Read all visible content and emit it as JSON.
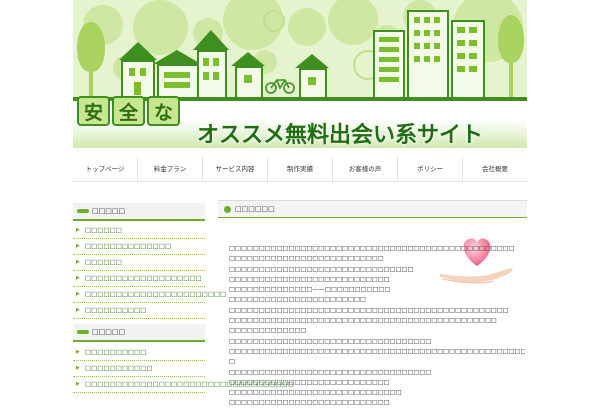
{
  "tagline": "□□□□□□□□□□□□□□□",
  "banner": {
    "badge_chars": [
      "安",
      "全",
      "な"
    ],
    "title": "オススメ無料出会い系サイト"
  },
  "nav": {
    "items": [
      "トップページ",
      "料金プラン",
      "サービス内容",
      "制作実績",
      "お客様の声",
      "ポリシー",
      "会社概要"
    ]
  },
  "sidebar": {
    "section1": {
      "title": "□□□□□",
      "items": [
        "□□□□□□",
        "□□□□□□□□□□□□□□",
        "□□□□□□",
        "□□□□□□□□□□□□□□□□□□□",
        "□□□□□□□□□□□□□□□□□□□□□□□",
        "□□□□□□□□□□"
      ]
    },
    "section2": {
      "title": "□□□□□",
      "items": [
        "□□□□□□□□□□",
        "□□□□□□□□□□□",
        "□□□□□□□□□□□□□□□□□□□□□□□□□□□□□□□□□□"
      ]
    }
  },
  "main": {
    "title": "□□□□□□",
    "paragraphs": [
      "□□□□□□□□□□□□□□□□□□□□□□□□□□□□□□□□□□□□□□□□□□□□□□□□",
      "□□□□□□□□□□□□□□□□□□□□□□□□□□",
      "□□□□□□□□□□□□□□□□□□□□□□□□□□□□□□□",
      "□□□□□□□□□□□□□□□□□□□□□□□□□□□",
      "□□□□□□□□□□□□□□——□□□□□□□□□□□",
      "□□□□□□□□□□□□□□□□□□□□□□□",
      "□□□□□□□□□□□□□□□□□□□□□□□□□□□□□□□□□□□□□□□□□□□□□□□",
      "□□□□□□□□□□□□□□□□□□□□□□□□□□□□□□□□□□□□□□□□□□□□□",
      "□□□□□□□□□□□□□",
      "□□□□□□□□□□□□□□□□□□□□□□□□□□□□□□□□□□",
      "□□□□□□□□□□□□□□□□□□□□□□□□□□□□□□□□□□□□□□□□□□□□□□□□□□□□□□□□□□□□□□□",
      "□",
      "□□□□□□□□□□□□□□□□□□□□□□□□□□□□□□□□□□",
      "□□□□□□□□□□□□□□□□□□□□□□□□□□□",
      "□□□□□□□□□□□□□□□□□□□□□□□□□□□□□",
      "□□□□□□□□□□□□□□□□□□□□□□□□□□□"
    ]
  },
  "colors": {
    "accent": "#6cae2a",
    "dark_green": "#3e8f1f",
    "banner_bg": "#e6f3cf"
  },
  "icons": [
    "heart-hand-image",
    "bicycle-icon"
  ]
}
